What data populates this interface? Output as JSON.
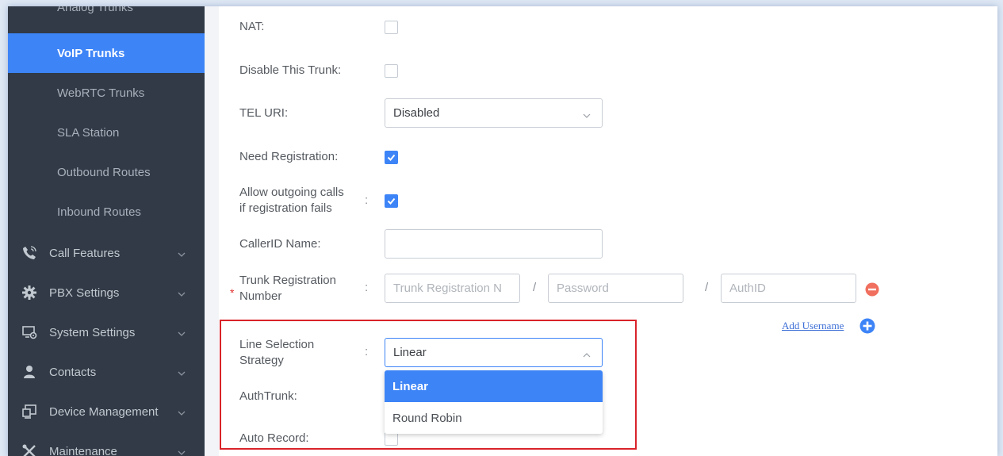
{
  "sidebar": {
    "items": [
      {
        "label": "Analog Trunks"
      },
      {
        "label": "VoIP Trunks",
        "active": true
      },
      {
        "label": "WebRTC Trunks"
      },
      {
        "label": "SLA Station"
      },
      {
        "label": "Outbound Routes"
      },
      {
        "label": "Inbound Routes"
      }
    ],
    "sections": [
      {
        "label": "Call Features",
        "icon": "phone-icon"
      },
      {
        "label": "PBX Settings",
        "icon": "gear-icon"
      },
      {
        "label": "System Settings",
        "icon": "system-settings-icon"
      },
      {
        "label": "Contacts",
        "icon": "person-icon"
      },
      {
        "label": "Device Management",
        "icon": "device-icon"
      },
      {
        "label": "Maintenance",
        "icon": "tools-icon"
      }
    ]
  },
  "form": {
    "nat": {
      "label": "NAT",
      "checked": false
    },
    "disable_trunk": {
      "label": "Disable This Trunk",
      "checked": false
    },
    "tel_uri": {
      "label": "TEL URI",
      "value": "Disabled"
    },
    "need_registration": {
      "label": "Need Registration",
      "checked": true
    },
    "allow_outgoing": {
      "label_line1": "Allow outgoing calls",
      "label_line2": "if registration fails",
      "checked": true
    },
    "callerid_name": {
      "label": "CallerID Name",
      "value": ""
    },
    "trunk_registration": {
      "label_line1": "Trunk Registration",
      "label_line2": "Number",
      "required_mark": "*",
      "number_placeholder": "Trunk Registration N",
      "password_placeholder": "Password",
      "authid_placeholder": "AuthID",
      "separator": "/"
    },
    "add_username": "Add Username",
    "line_selection": {
      "label_line1": "Line Selection",
      "label_line2": "Strategy",
      "value": "Linear",
      "options": [
        "Linear",
        "Round Robin"
      ]
    },
    "auth_trunk": {
      "label": "AuthTrunk"
    },
    "auto_record": {
      "label": "Auto Record"
    }
  },
  "colors": {
    "sidebar_bg": "#313a46",
    "accent": "#3d84f7",
    "highlight_border": "#d9232a",
    "remove": "#f06f5e"
  }
}
